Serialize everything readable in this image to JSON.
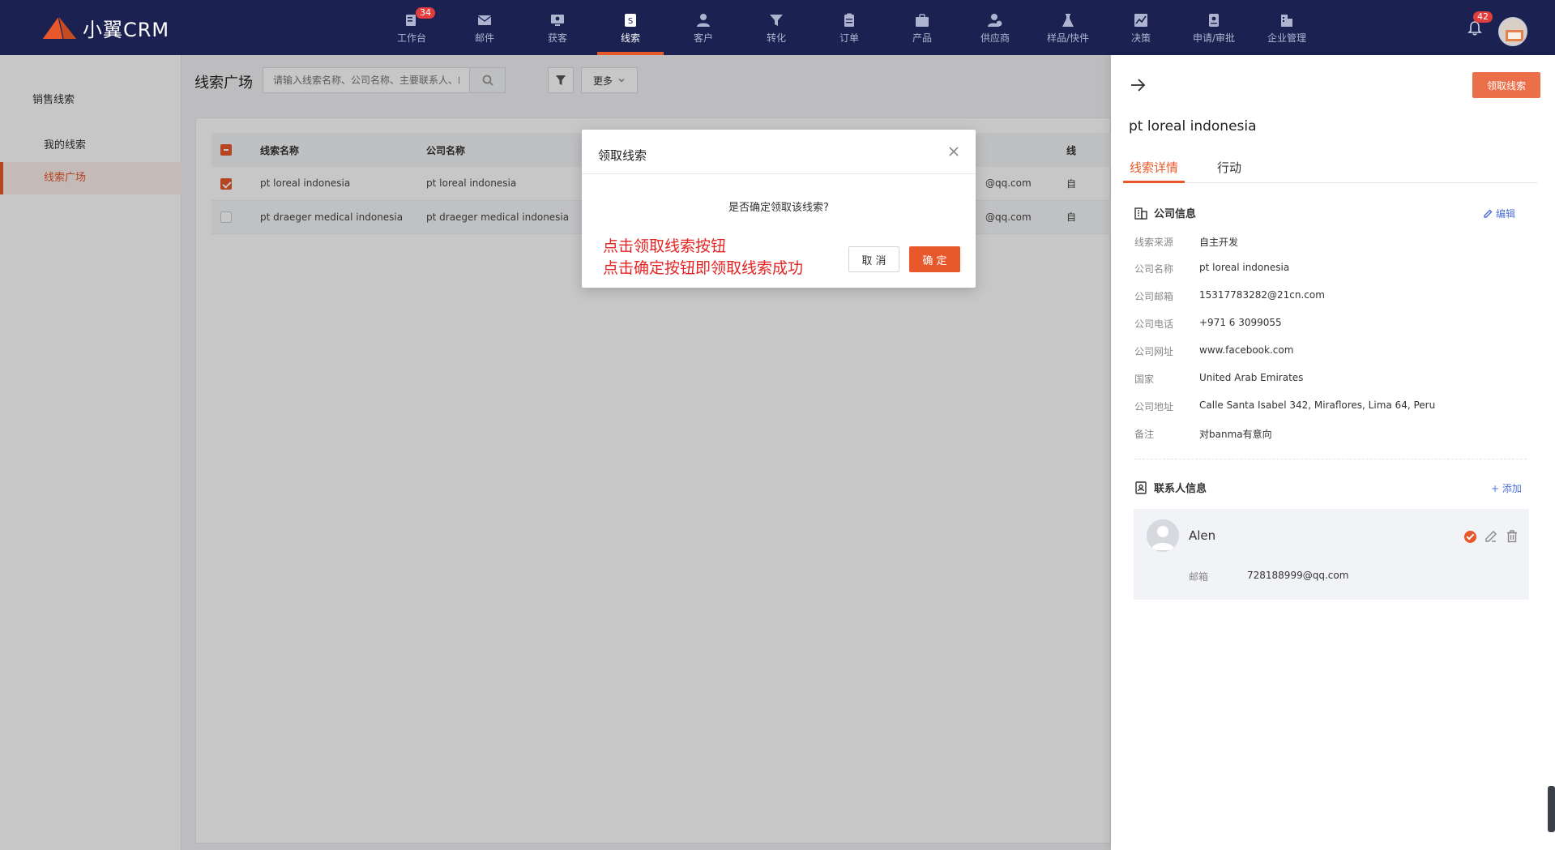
{
  "app": {
    "logo_text": "小翼CRM",
    "accent_color": "#e8582b",
    "nav_bg": "#1b2150"
  },
  "nav": [
    {
      "label": "工作台",
      "icon": "dashboard-icon",
      "badge": "34"
    },
    {
      "label": "邮件",
      "icon": "mail-icon"
    },
    {
      "label": "获客",
      "icon": "acquire-icon"
    },
    {
      "label": "线索",
      "icon": "leads-icon",
      "active": true
    },
    {
      "label": "客户",
      "icon": "customer-icon"
    },
    {
      "label": "转化",
      "icon": "funnel-icon"
    },
    {
      "label": "订单",
      "icon": "order-icon"
    },
    {
      "label": "产品",
      "icon": "product-icon"
    },
    {
      "label": "供应商",
      "icon": "supplier-icon"
    },
    {
      "label": "样品/快件",
      "icon": "flask-icon"
    },
    {
      "label": "决策",
      "icon": "chart-icon"
    },
    {
      "label": "申请/审批",
      "icon": "approval-icon"
    },
    {
      "label": "企业管理",
      "icon": "building-icon"
    }
  ],
  "notifications": {
    "count": "42"
  },
  "sidebar": {
    "group": "销售线索",
    "items": [
      {
        "label": "我的线索"
      },
      {
        "label": "线索广场",
        "active": true
      }
    ]
  },
  "main": {
    "title": "线索广场",
    "search_placeholder": "请输入线索名称、公司名称、主要联系人、邮箱",
    "more_label": "更多"
  },
  "table": {
    "columns": [
      "线索名称",
      "公司名称",
      "线"
    ],
    "rows": [
      {
        "name": "pt loreal indonesia",
        "company": "pt loreal indonesia",
        "email_tail": "@qq.com",
        "source_tail": "自",
        "checked": true
      },
      {
        "name": "pt draeger medical indonesia",
        "company": "pt draeger medical indonesia",
        "email_tail": "@qq.com",
        "source_tail": "自",
        "checked": false
      }
    ]
  },
  "dialog": {
    "title": "领取线索",
    "message": "是否确定领取该线索?",
    "note_line1": "点击领取线索按钮",
    "note_line2": "点击确定按钮即领取线索成功",
    "cancel_label": "取 消",
    "ok_label": "确 定"
  },
  "panel": {
    "claim_label": "领取线索",
    "lead_name": "pt loreal indonesia",
    "tabs": [
      "线索详情",
      "行动"
    ],
    "company_section": {
      "title": "公司信息",
      "edit_label": "编辑",
      "fields": [
        {
          "label": "线索来源",
          "value": "自主开发"
        },
        {
          "label": "公司名称",
          "value": "pt loreal indonesia"
        },
        {
          "label": "公司邮箱",
          "value": "15317783282@21cn.com"
        },
        {
          "label": "公司电话",
          "value": "+971 6 3099055"
        },
        {
          "label": "公司网址",
          "value": "www.facebook.com"
        },
        {
          "label": "国家",
          "value": "United Arab Emirates"
        },
        {
          "label": "公司地址",
          "value": "Calle Santa Isabel 342, Miraflores, Lima 64, Peru"
        },
        {
          "label": "备注",
          "value": "对banma有意向"
        }
      ]
    },
    "contact_section": {
      "title": "联系人信息",
      "add_label": "+ 添加",
      "contact": {
        "name": "Alen",
        "email_label": "邮箱",
        "email": "728188999@qq.com"
      }
    }
  }
}
